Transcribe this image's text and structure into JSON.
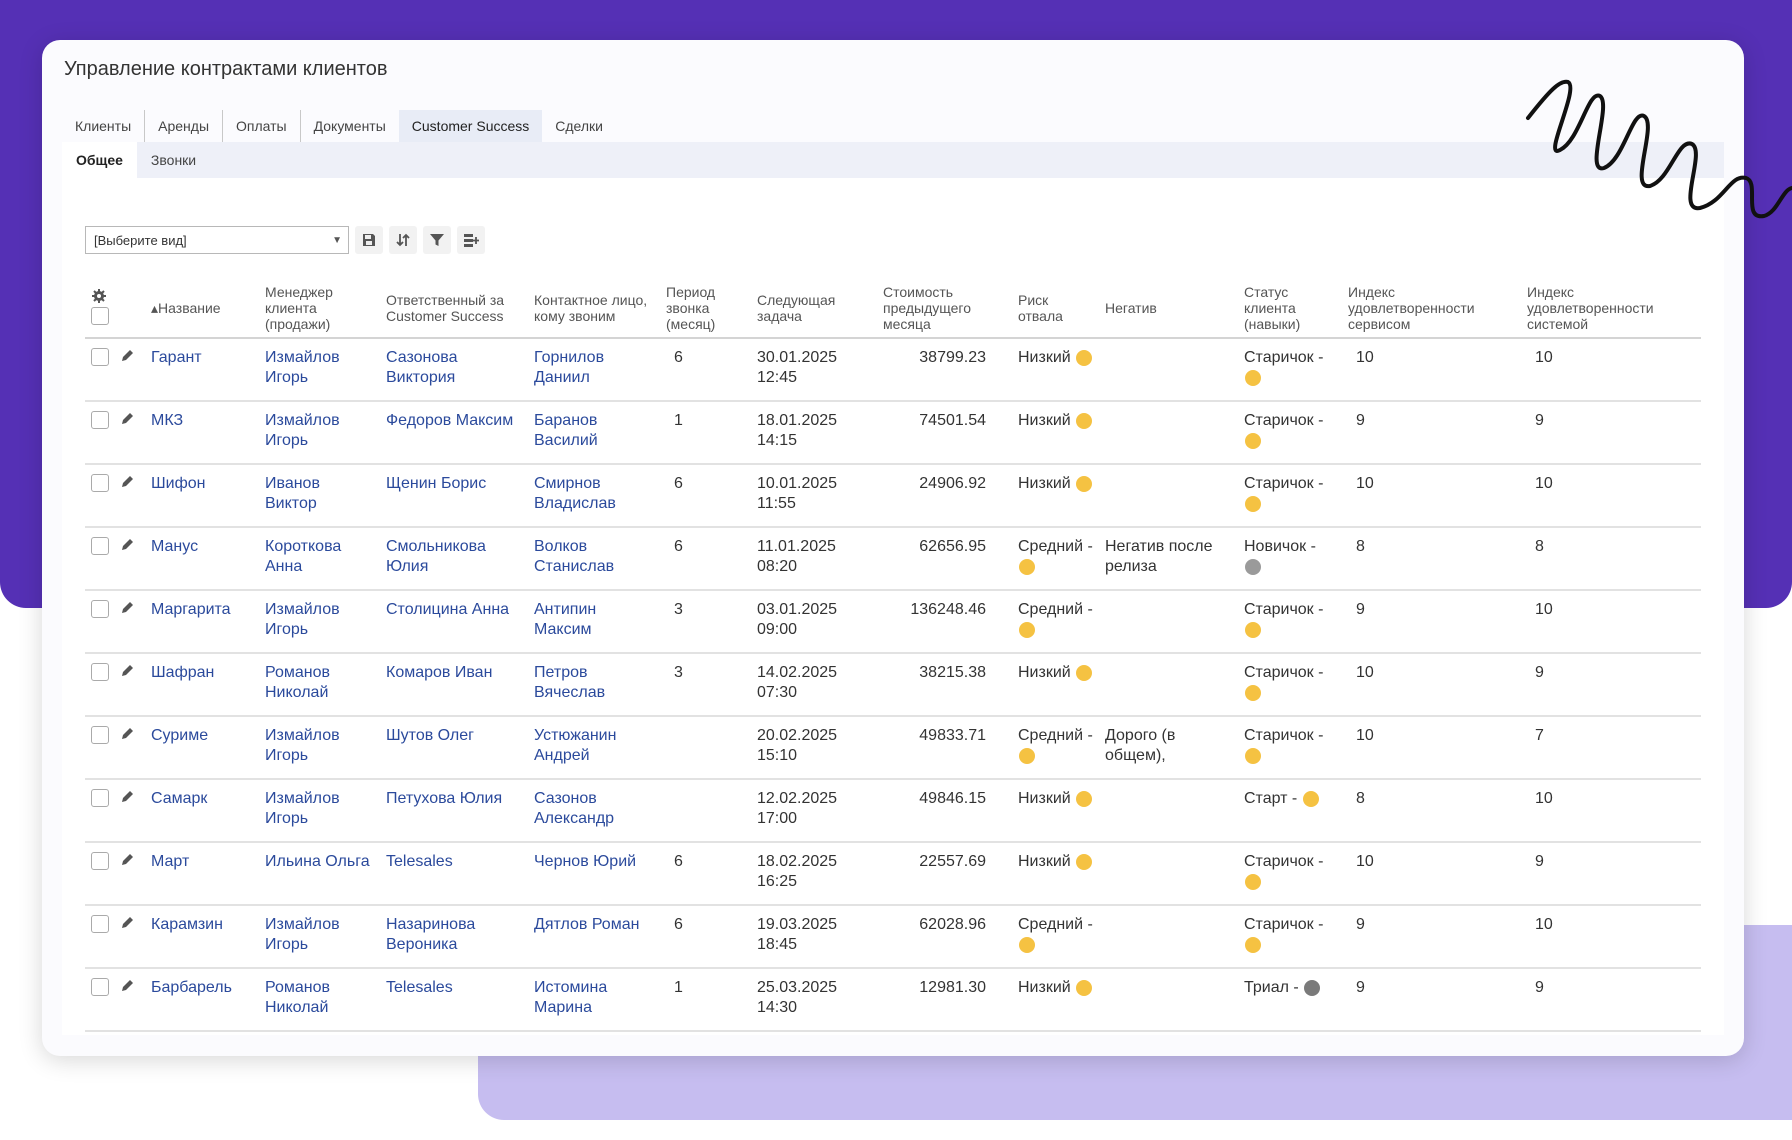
{
  "window": {
    "title": "Управление контрактами клиентов"
  },
  "tabs": [
    {
      "label": "Клиенты",
      "active": false
    },
    {
      "label": "Аренды",
      "active": false
    },
    {
      "label": "Оплаты",
      "active": false
    },
    {
      "label": "Документы",
      "active": false
    },
    {
      "label": "Customer Success",
      "active": true
    },
    {
      "label": "Сделки",
      "active": false
    }
  ],
  "subtabs": [
    {
      "label": "Общее",
      "active": true
    },
    {
      "label": "Звонки",
      "active": false
    }
  ],
  "toolbar": {
    "view_select_value": "[Выберите вид]",
    "buttons": [
      "save-icon",
      "sort-icon",
      "filter-icon",
      "columns-icon"
    ]
  },
  "table": {
    "headers": [
      "Название",
      "Менеджер клиента (продажи)",
      "Ответственный за Customer Success",
      "Контактное лицо, кому звоним",
      "Период звонка (месяц)",
      "Следующая задача",
      "Стоимость предыдущего месяца",
      "Риск отвала",
      "Негатив",
      "Статус клиента (навыки)",
      "Индекс удовлетворенности сервисом",
      "Индекс удовлетворенности системой"
    ],
    "rows": [
      {
        "name": "Гарант",
        "manager": "Измайлов Игорь",
        "cs": "Сазонова Виктория",
        "contact": "Горнилов Даниил",
        "period": "6",
        "task": "30.01.2025 12:45",
        "cost": "38799.23",
        "risk": "Низкий",
        "negative": "",
        "status": "Старичок -",
        "svc": "10",
        "sys": "10"
      },
      {
        "name": "МКЗ",
        "manager": "Измайлов Игорь",
        "cs": "Федоров Максим",
        "contact": "Баранов Василий",
        "period": "1",
        "task": "18.01.2025 14:15",
        "cost": "74501.54",
        "risk": "Низкий",
        "negative": "",
        "status": "Старичок -",
        "svc": "9",
        "sys": "9"
      },
      {
        "name": "Шифон",
        "manager": "Иванов Виктор",
        "cs": "Щенин Борис",
        "contact": "Смирнов Владислав",
        "period": "6",
        "task": "10.01.2025 11:55",
        "cost": "24906.92",
        "risk": "Низкий",
        "negative": "",
        "status": "Старичок -",
        "svc": "10",
        "sys": "10"
      },
      {
        "name": "Манус",
        "manager": "Короткова Анна",
        "cs": "Смольникова Юлия",
        "contact": "Волков Станислав",
        "period": "6",
        "task": "11.01.2025 08:20",
        "cost": "62656.95",
        "risk": "Средний -",
        "negative": "Негатив после релиза",
        "status": "Новичок -",
        "svc": "8",
        "sys": "8"
      },
      {
        "name": "Маргарита",
        "manager": "Измайлов Игорь",
        "cs": "Столицина Анна",
        "contact": "Антипин Максим",
        "period": "3",
        "task": "03.01.2025 09:00",
        "cost": "136248.46",
        "risk": "Средний -",
        "negative": "",
        "status": "Старичок -",
        "svc": "9",
        "sys": "10"
      },
      {
        "name": "Шафран",
        "manager": "Романов Николай",
        "cs": "Комаров Иван",
        "contact": "Петров Вячеслав",
        "period": "3",
        "task": "14.02.2025 07:30",
        "cost": "38215.38",
        "risk": "Низкий",
        "negative": "",
        "status": "Старичок -",
        "svc": "10",
        "sys": "9"
      },
      {
        "name": "Суриме",
        "manager": "Измайлов Игорь",
        "cs": "Шутов Олег",
        "contact": "Устюжанин Андрей",
        "period": "",
        "task": "20.02.2025 15:10",
        "cost": "49833.71",
        "risk": "Средний -",
        "negative": "Дорого (в общем),",
        "status": "Старичок -",
        "svc": "10",
        "sys": "7"
      },
      {
        "name": "Самарк",
        "manager": "Измайлов Игорь",
        "cs": "Петухова Юлия",
        "contact": "Сазонов Александр",
        "period": "",
        "task": "12.02.2025 17:00",
        "cost": "49846.15",
        "risk": "Низкий",
        "negative": "",
        "status": "Старт -",
        "svc": "8",
        "sys": "10"
      },
      {
        "name": "Март",
        "manager": "Ильина Ольга",
        "cs": "Telesales",
        "contact": "Чернов Юрий",
        "period": "6",
        "task": "18.02.2025 16:25",
        "cost": "22557.69",
        "risk": "Низкий",
        "negative": "",
        "status": "Старичок -",
        "svc": "10",
        "sys": "9"
      },
      {
        "name": "Карамзин",
        "manager": "Измайлов Игорь",
        "cs": "Назаринова Вероника",
        "contact": "Дятлов Роман",
        "period": "6",
        "task": "19.03.2025 18:45",
        "cost": "62028.96",
        "risk": "Средний -",
        "negative": "",
        "status": "Старичок -",
        "svc": "9",
        "sys": "10"
      },
      {
        "name": "Барбарель",
        "manager": "Романов Николай",
        "cs": "Telesales",
        "contact": "Истомина Марина",
        "period": "1",
        "task": "25.03.2025 14:30",
        "cost": "12981.30",
        "risk": "Низкий",
        "negative": "",
        "status": "Триал -",
        "svc": "9",
        "sys": "9"
      }
    ]
  },
  "colors": {
    "brand_purple": "#5530b5",
    "lavender": "#c6bdf0",
    "link": "#2b4a9c"
  }
}
